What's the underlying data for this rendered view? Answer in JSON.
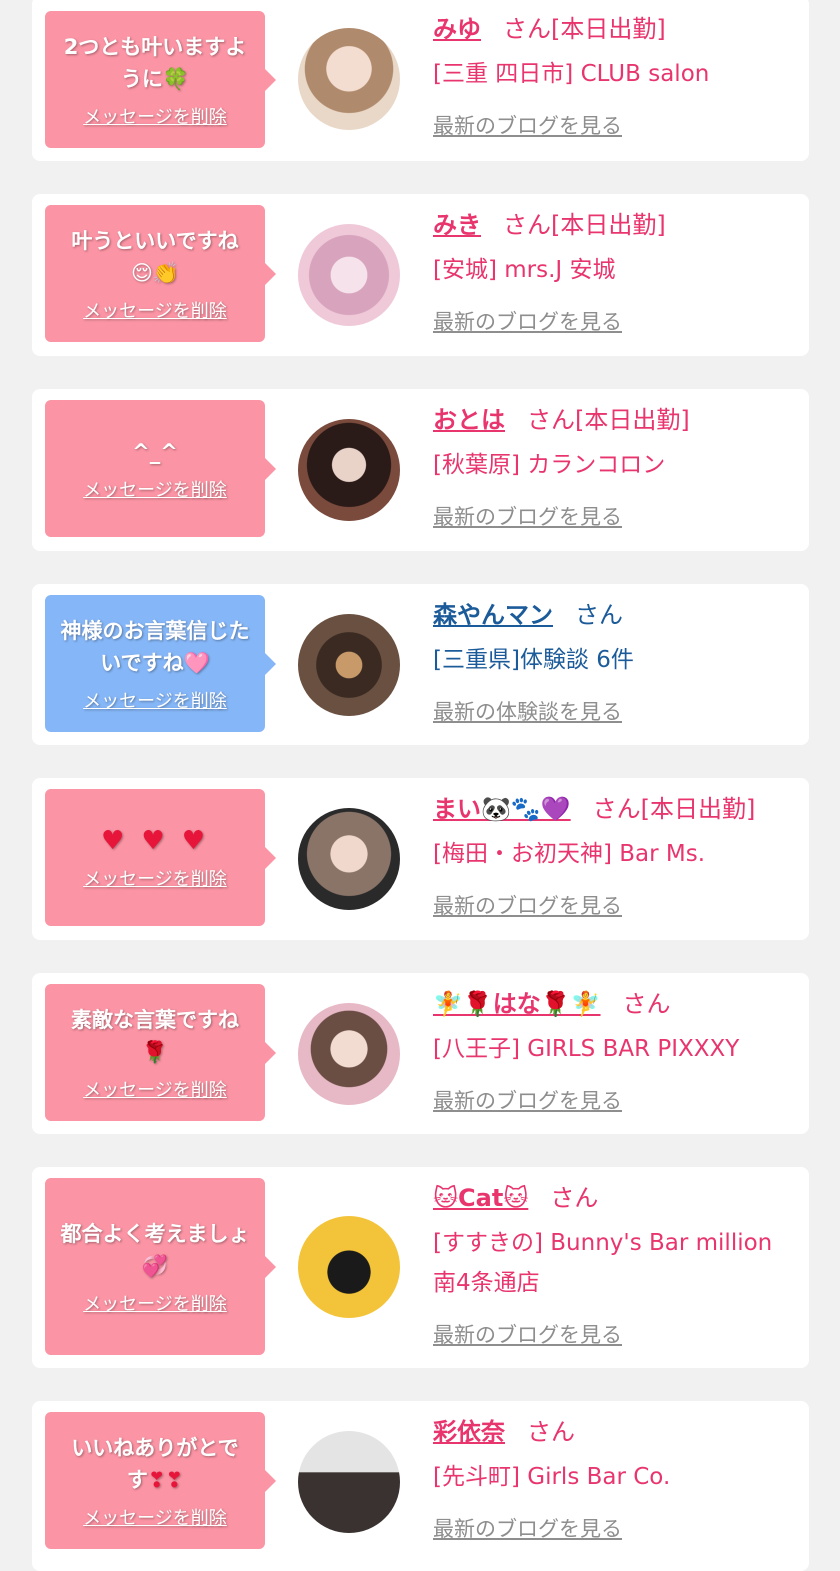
{
  "delete_label": "メッセージを削除",
  "san": "さん",
  "cards": [
    {
      "message": "2つとも叶いますように",
      "emoji": "🍀",
      "name": "みゆ",
      "suffix": "さん[本日出勤]",
      "shop": "[三重 四日市] CLUB salon",
      "more": "最新のブログを見る"
    },
    {
      "message": "叶うといいですね",
      "emoji": "😌👏",
      "name": "みき",
      "suffix": "さん[本日出勤]",
      "shop": "[安城] mrs.J 安城",
      "more": "最新のブログを見る"
    },
    {
      "message": "^_^",
      "emoji": "",
      "name": "おとは",
      "suffix": "さん[本日出勤]",
      "shop": "[秋葉原] カランコロン",
      "more": "最新のブログを見る"
    },
    {
      "message": "神様のお言葉信じたいですね",
      "emoji": "🩷",
      "name": "森やんマン",
      "suffix": "さん",
      "shop": "[三重県]体験談 6件",
      "more": "最新の体験談を見る"
    },
    {
      "message": "",
      "emoji": "♥ ♥ ♥",
      "name": "まい🐼🐾💜",
      "suffix": "さん[本日出勤]",
      "shop": "[梅田・お初天神] Bar Ms.",
      "more": "最新のブログを見る"
    },
    {
      "message": "素敵な言葉ですね",
      "emoji": "🌹",
      "name": "🧚🌹はな🌹🧚",
      "suffix": "さん",
      "shop": "[八王子] GIRLS BAR PIXXXY",
      "more": "最新のブログを見る"
    },
    {
      "message": "都合よく考えましょ",
      "emoji": "💞",
      "name": "🐱Cat🐱",
      "suffix": "さん",
      "shop": "[すすきの] Bunny's Bar million 南4条通店",
      "more": "最新のブログを見る"
    },
    {
      "message": "いいねありがとです",
      "emoji": "❣❣",
      "name": "彩依奈",
      "suffix": "さん",
      "shop": "[先斗町] Girls Bar Co.",
      "more": "最新のブログを見る"
    }
  ],
  "colors": {
    "bubble_pink": "#fb94a4",
    "bubble_blue": "#85b6f7",
    "cast_text": "#e8356e",
    "user_text": "#1c5b9a",
    "link_gray": "#8e8e8e"
  }
}
